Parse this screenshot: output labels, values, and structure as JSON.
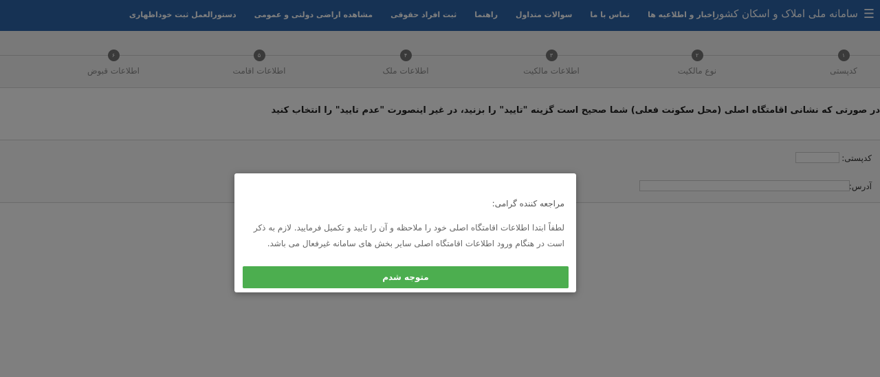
{
  "header": {
    "brand": "سامانه ملی املاک و اسکان کشور",
    "menu_icon": "hamburger-icon",
    "links": [
      "اخبار و اطلاعیه ها",
      "تماس با ما",
      "سوالات متداول",
      "راهنما",
      "ثبت افراد حقوقی",
      "مشاهده اراضی دولتی و عمومی",
      "دستورالعمل ثبت خوداظهاری"
    ]
  },
  "steps": [
    {
      "number": "۱",
      "label": "کدپستی"
    },
    {
      "number": "۲",
      "label": "نوع مالکیت"
    },
    {
      "number": "۳",
      "label": "اطلاعات مالکیت"
    },
    {
      "number": "۴",
      "label": "اطلاعات ملک"
    },
    {
      "number": "۵",
      "label": "اطلاعات اقامت"
    },
    {
      "number": "۶",
      "label": "اطلاعات قبوض"
    }
  ],
  "main": {
    "question": "در صورتی که نشانی اقامتگاه اصلی (محل سکونت فعلی) شما صحیح است گزینه \"تایید\" را بزنید، در غیر اینصورت \"عدم تایید\" را انتخاب کنید",
    "postal_code_label": "کدپستی:",
    "postal_code_value": "",
    "address_label": "آدرس:",
    "address_value": ""
  },
  "modal": {
    "greeting": "مراجعه کننده گرامی:",
    "body": "لطفاً ابتدا اطلاعات اقامتگاه اصلی خود را ملاحظه و آن را تایید و تکمیل فرمایید. لازم به ذکر است در هنگام ورود اطلاعات اقامتگاه اصلی سایر بخش های سامانه غیرفعال می باشد.",
    "button_label": "متوجه شدم",
    "button_color": "#4cae4f"
  },
  "colors": {
    "header_bg": "#2d64a8",
    "step_dot": "#757575",
    "overlay": "rgba(0,0,0,0.5)"
  }
}
